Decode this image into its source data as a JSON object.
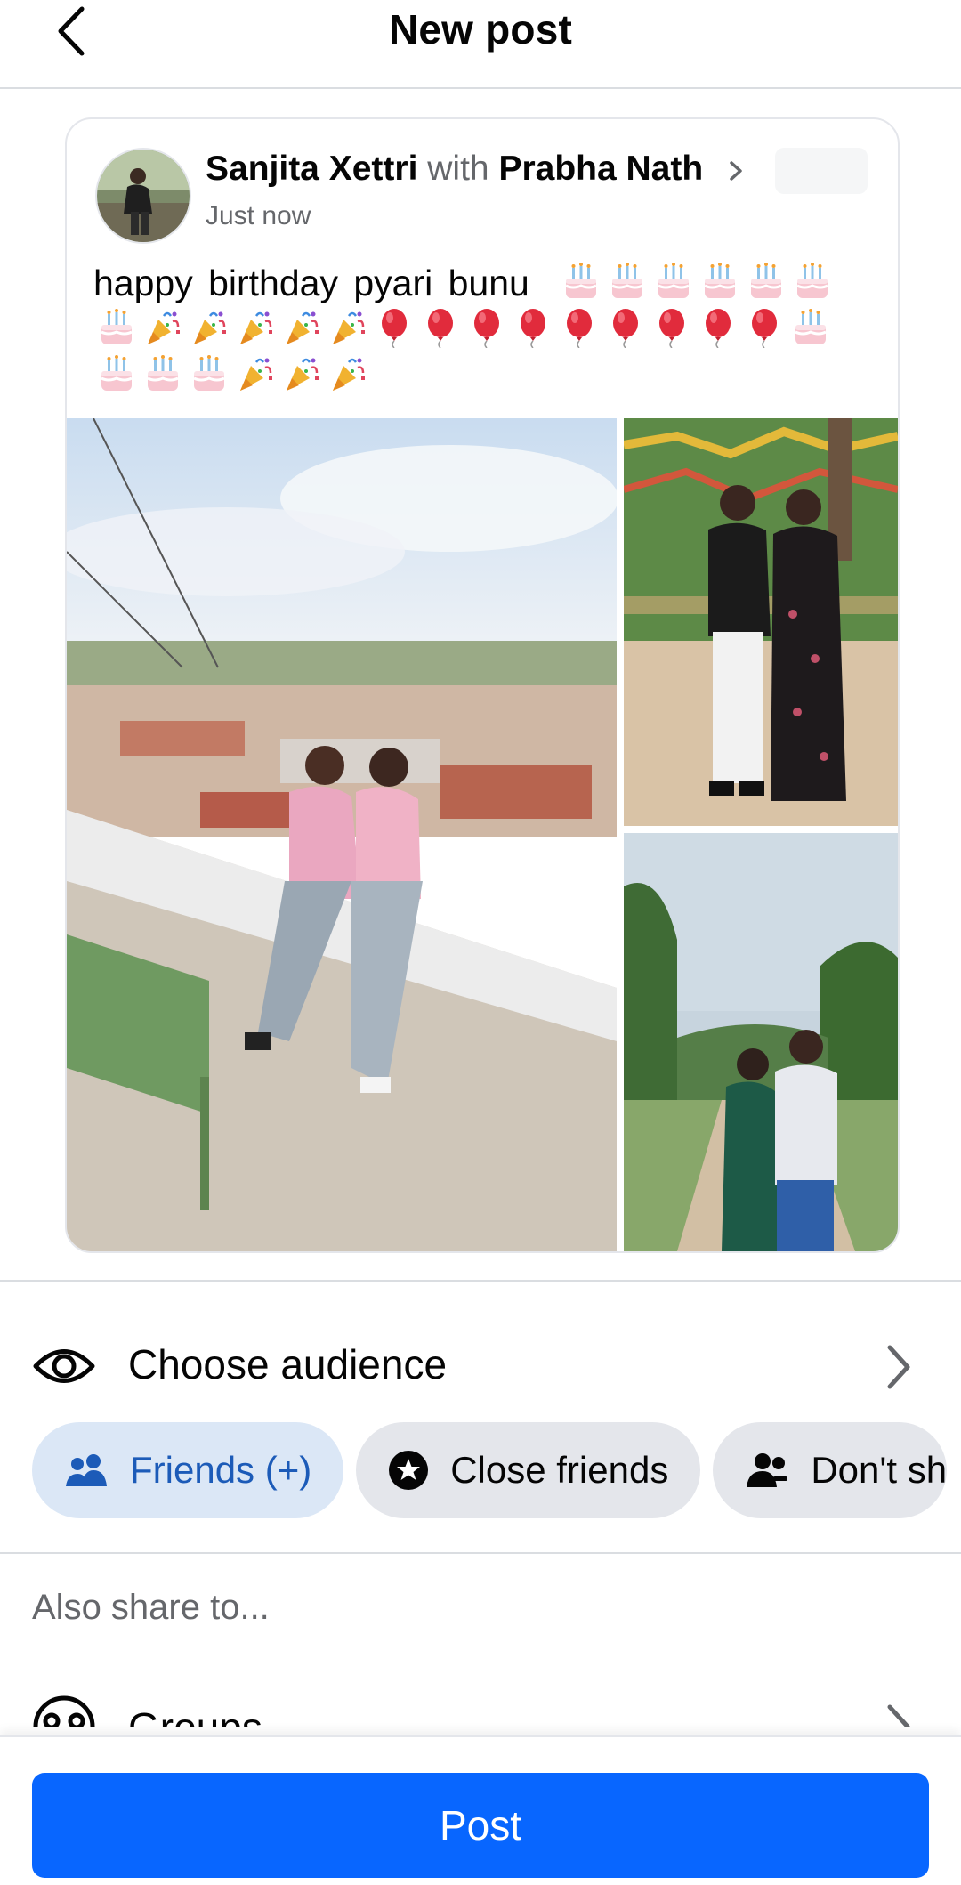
{
  "header": {
    "title": "New post",
    "back_icon": "back-arrow-icon"
  },
  "post": {
    "author": "Sanjita Xettri",
    "with_word": "with",
    "tagged": "Prabha Nath",
    "time": "Just now",
    "caption": "happy  birthday  pyari bunu",
    "emoji_lines": [
      [
        "cake",
        "cake",
        "cake",
        "cake",
        "cake",
        "cake"
      ],
      [
        "cake",
        "party-popper",
        "party-popper",
        "party-popper",
        "party-popper",
        "party-popper",
        "balloon",
        "balloon",
        "balloon",
        "balloon",
        "balloon",
        "balloon",
        "balloon",
        "balloon",
        "balloon",
        "cake"
      ],
      [
        "cake",
        "cake",
        "cake",
        "party-popper",
        "party-popper",
        "party-popper"
      ]
    ]
  },
  "audience": {
    "title": "Choose audience",
    "chips": [
      {
        "label": "Friends (+)",
        "icon": "friends-icon",
        "active": true
      },
      {
        "label": "Close friends",
        "icon": "star-icon",
        "active": false
      },
      {
        "label": "Don't sh",
        "icon": "people-minus-icon",
        "active": false
      }
    ],
    "colors": {
      "active_bg": "#dbe7f6",
      "active_text": "#1c5bb8",
      "chip_bg": "#e4e6eb"
    }
  },
  "also_share": "Also share to...",
  "groups": {
    "label": "Groups"
  },
  "footer": {
    "post_label": "Post",
    "button_color": "#0866ff"
  }
}
